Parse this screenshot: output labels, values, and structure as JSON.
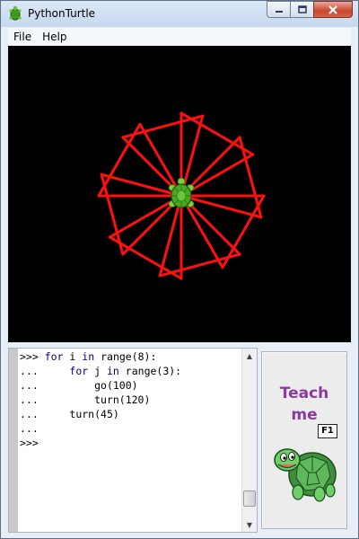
{
  "window": {
    "title": "PythonTurtle"
  },
  "menu": {
    "file": "File",
    "help": "Help"
  },
  "console": {
    "lines": [
      {
        "prompt": ">>>",
        "code": "for i in range(8):"
      },
      {
        "prompt": "...",
        "code": "    for j in range(3):"
      },
      {
        "prompt": "...",
        "code": "        go(100)"
      },
      {
        "prompt": "...",
        "code": "        turn(120)"
      },
      {
        "prompt": "...",
        "code": "    turn(45)"
      },
      {
        "prompt": "...",
        "code": ""
      },
      {
        "prompt": ">>>",
        "code": ""
      }
    ]
  },
  "help_panel": {
    "line1": "Teach",
    "line2": "me",
    "shortcut": "F1"
  },
  "colors": {
    "canvas_bg": "#000000",
    "pen": "#ff1010",
    "turtle_shell": "#4aa823",
    "teach_text": "#8b3aa0"
  },
  "drawing": {
    "loops": 8,
    "sides": 3,
    "step": 100,
    "turn_inner": 120,
    "turn_outer": 45
  }
}
